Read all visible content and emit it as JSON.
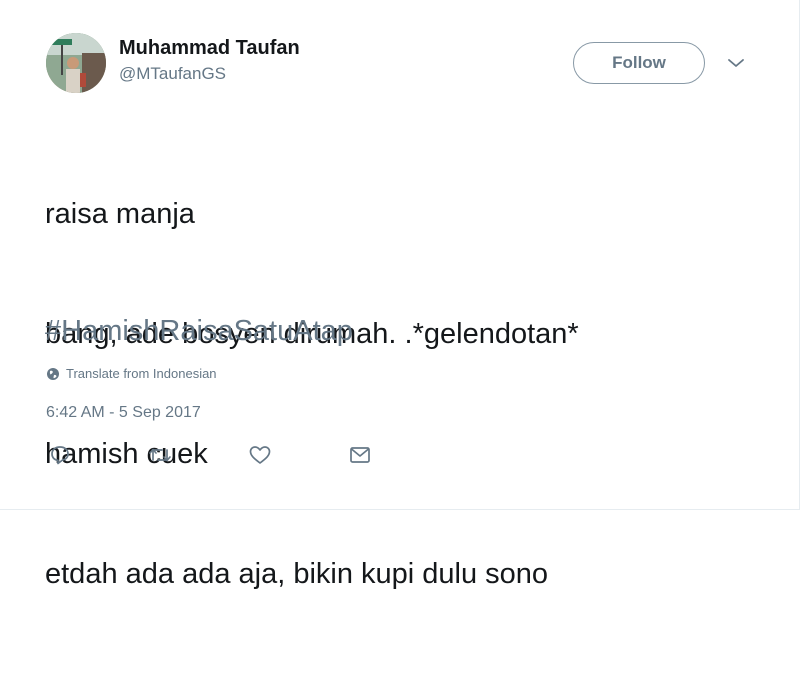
{
  "author": {
    "name": "Muhammad Taufan",
    "handle": "@MTaufanGS"
  },
  "follow_button": {
    "label": "Follow"
  },
  "tweet": {
    "lines": [
      "raisa manja",
      "bang, ade bosyen dirumah. .*gelendotan*",
      "hamish cuek",
      "etdah ada ada aja, bikin kupi dulu sono"
    ],
    "hashtag": "#HamishRaisaSatuAtap",
    "translate_label": "Translate from Indonesian",
    "timestamp": "6:42 AM - 5 Sep 2017"
  },
  "actions": {
    "reply_icon": "reply-icon",
    "retweet_icon": "retweet-icon",
    "like_icon": "heart-icon",
    "message_icon": "envelope-icon"
  },
  "colors": {
    "text": "#14171a",
    "secondary": "#657786",
    "border": "#8899a6"
  }
}
